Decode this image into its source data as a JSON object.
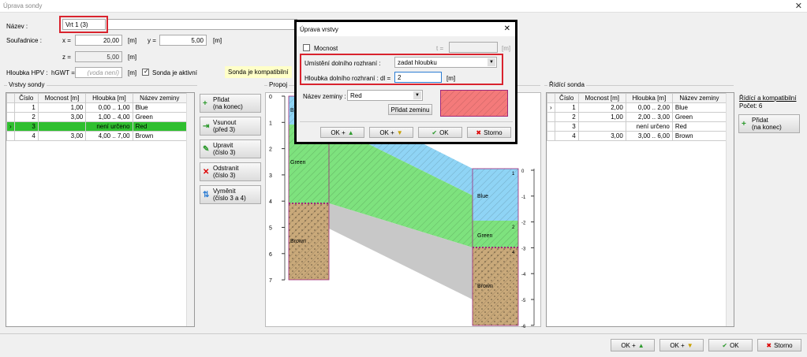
{
  "window": {
    "title": "Úprava sondy",
    "close": "✕"
  },
  "header": {
    "name_label": "Název :",
    "name_value": "Vrt 1 (3)",
    "coords_label": "Souřadnice :",
    "x_label": "x =",
    "x_value": "20,00",
    "x_unit": "[m]",
    "y_label": "y =",
    "y_value": "5,00",
    "y_unit": "[m]",
    "z_label": "z =",
    "z_value": "5,00",
    "z_unit": "[m]",
    "gwt_label": "Hloubka HPV :",
    "gwt_sym": "hGWT =",
    "gwt_placeholder": "(voda není)",
    "gwt_unit": "[m]",
    "active_label": "Sonda je aktivní",
    "compat_label": "Sonda je kompatibilní"
  },
  "layers": {
    "title": "Vrstvy sondy",
    "columns": [
      "Číslo",
      "Mocnost [m]",
      "Hloubka [m]",
      "Název zeminy"
    ],
    "rows": [
      {
        "marker": "",
        "num": "1",
        "thick": "1,00",
        "depth": "0,00 .. 1,00",
        "soil": "Blue"
      },
      {
        "marker": "",
        "num": "2",
        "thick": "3,00",
        "depth": "1,00 .. 4,00",
        "soil": "Green"
      },
      {
        "marker": "›",
        "num": "3",
        "thick": "",
        "depth": "není určeno",
        "soil": "Red"
      },
      {
        "marker": "",
        "num": "4",
        "thick": "3,00",
        "depth": "4,00 .. 7,00",
        "soil": "Brown"
      }
    ]
  },
  "side_buttons": [
    {
      "icon": "+",
      "label": "Přidat\n(na konec)"
    },
    {
      "icon": "⇥",
      "label": "Vsunout\n(před 3)"
    },
    {
      "icon": "✎",
      "label": "Upravit\n(číslo 3)"
    },
    {
      "icon": "✕",
      "label": "Odstranit\n(číslo 3)"
    },
    {
      "icon": "⇅",
      "label": "Vyměnit\n(číslo 3 a 4)"
    }
  ],
  "preview": {
    "title": "Propoj",
    "left_ticks": [
      "0",
      "1",
      "2",
      "3",
      "4",
      "5",
      "6",
      "7"
    ],
    "right_ticks": [
      "0",
      "-1",
      "-2",
      "-3",
      "-4",
      "-5",
      "-6"
    ],
    "left_soils": [
      "Blue",
      "Green",
      "Brown"
    ],
    "right_soils": [
      "Blue",
      "Green",
      "Brown"
    ],
    "right_nums": [
      "1",
      "2",
      "4"
    ]
  },
  "master": {
    "title": "Řídící sonda",
    "columns": [
      "Číslo",
      "Mocnost [m]",
      "Hloubka [m]",
      "Název zeminy"
    ],
    "rows": [
      {
        "marker": "›",
        "num": "1",
        "thick": "2,00",
        "depth": "0,00 .. 2,00",
        "soil": "Blue"
      },
      {
        "marker": "",
        "num": "2",
        "thick": "1,00",
        "depth": "2,00 .. 3,00",
        "soil": "Green"
      },
      {
        "marker": "",
        "num": "3",
        "thick": "",
        "depth": "není určeno",
        "soil": "Red"
      },
      {
        "marker": "",
        "num": "4",
        "thick": "3,00",
        "depth": "3,00 .. 6,00",
        "soil": "Brown"
      }
    ],
    "status_title": "Řídící a kompatibilní",
    "count": "Počet: 6",
    "add_label": "Přidat\n(na konec)"
  },
  "footer": {
    "ok_up": "OK +",
    "ok_down": "OK +",
    "ok": "OK",
    "cancel": "Storno"
  },
  "dialog": {
    "title": "Úprava vrstvy",
    "close": "✕",
    "thickness_label": "Mocnost",
    "t_label": "t =",
    "t_unit": "[m]",
    "placement_label": "Umístění dolního rozhraní :",
    "placement_value": "zadat hloubku",
    "depth_label": "Hloubka dolního rozhraní :",
    "depth_sym": "dl =",
    "depth_value": "2",
    "depth_unit": "[m]",
    "soil_label": "Název zeminy :",
    "soil_value": "Red",
    "add_soil": "Přidat zeminu",
    "ok_up": "OK +",
    "ok_down": "OK +",
    "ok": "OK",
    "cancel": "Storno"
  },
  "colors": {
    "selected_row": "#2fbf2f",
    "red_frame": "#d9232e",
    "blue": "#8fd4f5",
    "green": "#7ee27e",
    "brown": "#c9a97a",
    "red": "#f47a7a",
    "grey": "#c8c8c8"
  }
}
